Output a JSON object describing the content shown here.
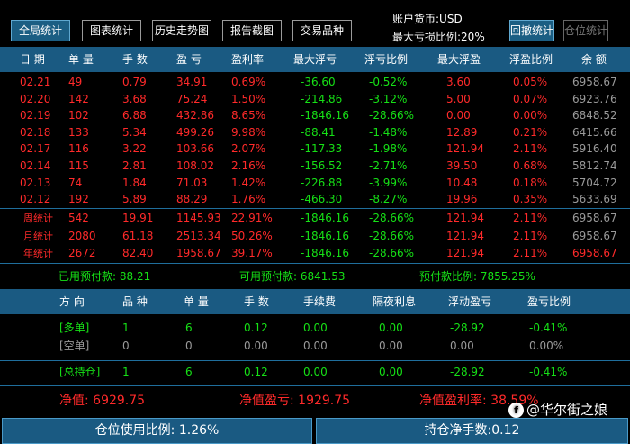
{
  "toolbar": {
    "buttons": [
      {
        "label": "全局统计",
        "state": "active"
      },
      {
        "label": "图表统计",
        "state": "normal"
      },
      {
        "label": "历史走势图",
        "state": "normal"
      },
      {
        "label": "报告截图",
        "state": "normal"
      },
      {
        "label": "交易品种",
        "state": "normal"
      }
    ],
    "account_currency": "账户货币:USD",
    "max_loss_ratio": "最大亏损比例:20%",
    "btn_cancel_stats": "回撤统计",
    "btn_position_stats": "仓位统计"
  },
  "table": {
    "headers": [
      "日 期",
      "单 量",
      "手 数",
      "盈 亏",
      "盈利率",
      "最大浮亏",
      "浮亏比例",
      "最大浮盈",
      "浮盈比例",
      "余 额"
    ],
    "rows": [
      [
        "02.21",
        "49",
        "0.79",
        "34.91",
        "0.69%",
        "-36.60",
        "-0.52%",
        "3.60",
        "0.05%",
        "6958.67"
      ],
      [
        "02.20",
        "142",
        "3.68",
        "75.24",
        "1.50%",
        "-214.86",
        "-3.12%",
        "5.00",
        "0.07%",
        "6923.76"
      ],
      [
        "02.19",
        "102",
        "6.88",
        "432.86",
        "8.65%",
        "-1846.16",
        "-28.66%",
        "0.00",
        "0.00%",
        "6848.52"
      ],
      [
        "02.18",
        "133",
        "5.34",
        "499.26",
        "9.98%",
        "-88.41",
        "-1.48%",
        "12.89",
        "0.21%",
        "6415.66"
      ],
      [
        "02.17",
        "116",
        "3.22",
        "103.66",
        "2.07%",
        "-117.33",
        "-1.98%",
        "121.94",
        "2.11%",
        "5916.40"
      ],
      [
        "02.14",
        "115",
        "2.81",
        "108.02",
        "2.16%",
        "-156.52",
        "-2.71%",
        "39.50",
        "0.68%",
        "5812.74"
      ],
      [
        "02.13",
        "74",
        "1.84",
        "71.03",
        "1.42%",
        "-226.88",
        "-3.99%",
        "10.48",
        "0.18%",
        "5704.72"
      ],
      [
        "02.12",
        "192",
        "5.89",
        "88.29",
        "1.76%",
        "-466.30",
        "-8.27%",
        "19.96",
        "0.35%",
        "5633.69"
      ]
    ],
    "summary": [
      [
        "周统计",
        "542",
        "19.91",
        "1145.93",
        "22.91%",
        "-1846.16",
        "-28.66%",
        "121.94",
        "2.11%",
        "6958.67"
      ],
      [
        "月统计",
        "2080",
        "61.18",
        "2513.34",
        "50.26%",
        "-1846.16",
        "-28.66%",
        "121.94",
        "2.11%",
        "6958.67"
      ],
      [
        "年统计",
        "2672",
        "82.40",
        "1958.67",
        "39.17%",
        "-1846.16",
        "-28.66%",
        "121.94",
        "2.11%",
        "6958.67"
      ]
    ]
  },
  "prepay": {
    "used": "已用预付款: 88.21",
    "available": "可用预付款: 6841.53",
    "ratio": "预付款比例: 7855.25%"
  },
  "positions": {
    "headers": [
      "方 向",
      "品 种",
      "单 量",
      "手 数",
      "手续费",
      "隔夜利息",
      "浮动盈亏",
      "盈亏比例"
    ],
    "rows": [
      [
        "[多单]",
        "1",
        "6",
        "0.12",
        "0.00",
        "0.00",
        "-28.92",
        "-0.41%"
      ],
      [
        "[空单]",
        "0",
        "0",
        "0.00",
        "0.00",
        "0.00",
        "0.00",
        "0.00%"
      ]
    ],
    "total": [
      "[总持仓]",
      "1",
      "6",
      "0.12",
      "0.00",
      "0.00",
      "-28.92",
      "-0.41%"
    ]
  },
  "net": {
    "value": "净值: 6929.75",
    "profit": "净值盈亏: 1929.75",
    "rate": "净值盈利率: 38.59%"
  },
  "footer": {
    "usage": "仓位使用比例: 1.26%",
    "net_lots": "持仓净手数:0.12"
  },
  "watermark": {
    "text": "@华尔街之娘",
    "logo_letter": "f"
  },
  "colors": {
    "header_bg": "#1a5a82",
    "profit_red": "#ff2a2a",
    "loss_green": "#16e016"
  }
}
